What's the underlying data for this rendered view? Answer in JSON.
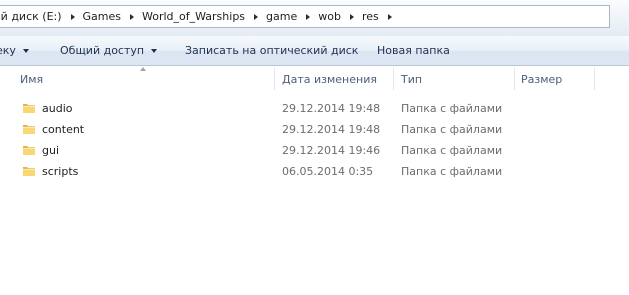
{
  "address": {
    "crumbs": [
      "ый диск (E:)",
      "Games",
      "World_of_Warships",
      "game",
      "wob",
      "res"
    ]
  },
  "commands": {
    "partial_menu": "еку",
    "share": "Общий доступ",
    "burn": "Записать на оптический диск",
    "new_folder": "Новая папка"
  },
  "columns": {
    "name": "Имя",
    "date": "Дата изменения",
    "type": "Тип",
    "size": "Размер"
  },
  "files": [
    {
      "name": "audio",
      "date": "29.12.2014 19:48",
      "type": "Папка с файлами",
      "icon": "folder-icon"
    },
    {
      "name": "content",
      "date": "29.12.2014 19:48",
      "type": "Папка с файлами",
      "icon": "folder-icon"
    },
    {
      "name": "gui",
      "date": "29.12.2014 19:46",
      "type": "Папка с файлами",
      "icon": "folder-icon"
    },
    {
      "name": "scripts",
      "date": "06.05.2014 0:35",
      "type": "Папка с файлами",
      "icon": "folder-icon"
    }
  ],
  "colors": {
    "folder": "#f2c94c",
    "header_text": "#4c607a",
    "meta_text": "#6d6d6d"
  }
}
